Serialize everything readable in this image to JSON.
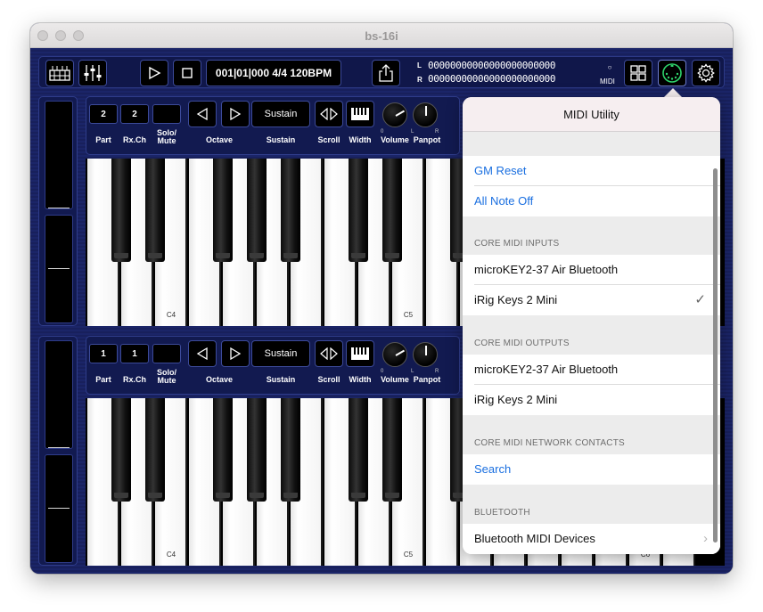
{
  "window": {
    "title": "bs-16i"
  },
  "toolbar": {
    "position": "001|01|000 4/4 120BPM",
    "meter_left_label": "L",
    "meter_right_label": "R",
    "meter_left": "00000000000000000000000",
    "meter_right": "00000000000000000000000",
    "midi_indicator": "○",
    "midi_label": "MIDI"
  },
  "parts": [
    {
      "part": "2",
      "rx_ch": "2",
      "solo_mute": "",
      "sustain": "Sustain",
      "labels": {
        "part": "Part",
        "rx_ch": "Rx.Ch",
        "solo": "Solo/",
        "mute": "Mute",
        "octave": "Octave",
        "sustain": "Sustain",
        "scroll": "Scroll",
        "width": "Width",
        "volume": "Volume",
        "panpot": "Panpot"
      },
      "knob_scale": {
        "zero": "0",
        "l": "L",
        "r": "R"
      },
      "key_labels": {
        "c4": "C4",
        "c5": "C5"
      }
    },
    {
      "part": "1",
      "rx_ch": "1",
      "solo_mute": "",
      "sustain": "Sustain",
      "labels": {
        "part": "Part",
        "rx_ch": "Rx.Ch",
        "solo": "Solo/",
        "mute": "Mute",
        "octave": "Octave",
        "sustain": "Sustain",
        "scroll": "Scroll",
        "width": "Width",
        "volume": "Volume",
        "panpot": "Panpot"
      },
      "knob_scale": {
        "zero": "0",
        "l": "L",
        "r": "R"
      },
      "key_labels": {
        "c4": "C4",
        "c5": "C5",
        "c6": "C6"
      }
    }
  ],
  "popover": {
    "title": "MIDI Utility",
    "gm_reset": "GM Reset",
    "all_note_off": "All Note Off",
    "inputs_header": "CORE MIDI INPUTS",
    "inputs": [
      {
        "name": "microKEY2-37 Air Bluetooth",
        "checked": false
      },
      {
        "name": "iRig Keys 2 Mini",
        "checked": true
      }
    ],
    "outputs_header": "CORE MIDI OUTPUTS",
    "outputs": [
      {
        "name": "microKEY2-37 Air Bluetooth"
      },
      {
        "name": "iRig Keys 2 Mini"
      }
    ],
    "network_header": "CORE MIDI NETWORK CONTACTS",
    "search": "Search",
    "bluetooth_header": "BLUETOOTH",
    "bluetooth_devices": "Bluetooth MIDI Devices",
    "check_mark": "✓",
    "chevron": "›"
  },
  "colors": {
    "app_background": "#1b2568",
    "accent_link": "#1a6fe0",
    "midi_ring": "#2ed36b"
  }
}
